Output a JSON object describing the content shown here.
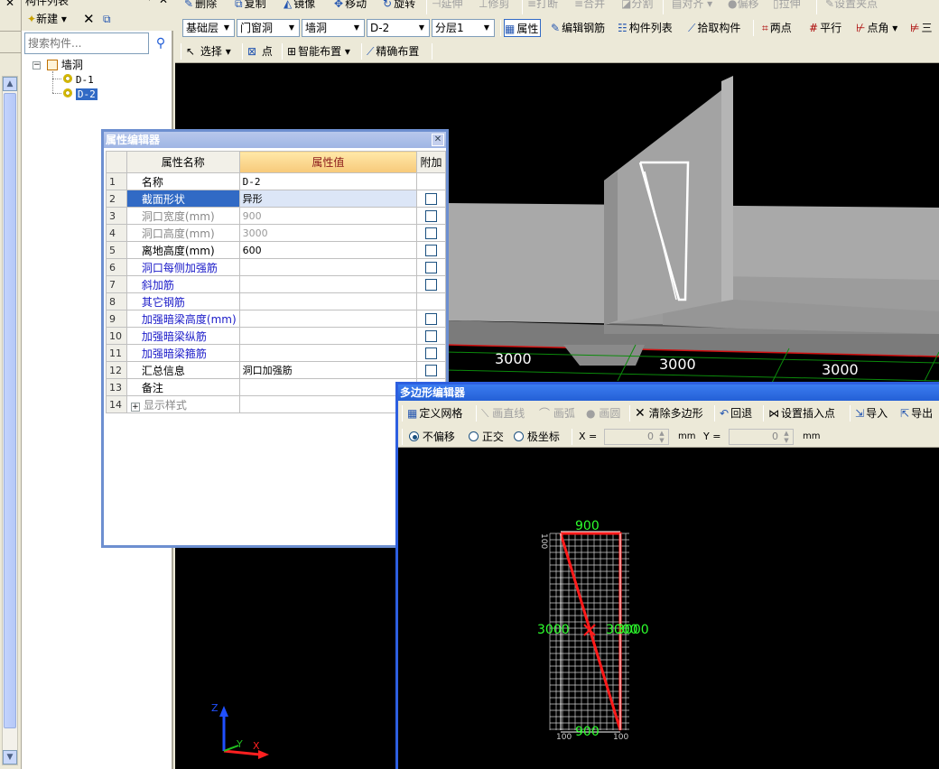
{
  "comp_panel": {
    "title": "构件列表",
    "new_label": "新建",
    "search_placeholder": "搜索构件...",
    "tree": {
      "root_label": "墙洞",
      "items": [
        "D-1",
        "D-2"
      ]
    }
  },
  "toolbar1": {
    "items": [
      "删除",
      "复制",
      "镜像",
      "移动",
      "旋转",
      "延伸",
      "修剪",
      "打断",
      "合并",
      "分割",
      "对齐",
      "偏移",
      "拉伸",
      "设置夹点"
    ]
  },
  "toolbar2": {
    "floor_combo": "基础层",
    "type_combo": "门窗洞",
    "sub_combo": "墙洞",
    "name_combo": "D-2",
    "layer_combo": "分层1",
    "attr_btn": "属性",
    "edit_rebar_btn": "编辑钢筋",
    "comp_list_btn": "构件列表",
    "pick_btn": "拾取构件",
    "two_point_btn": "两点",
    "parallel_btn": "平行",
    "point_angle_btn": "点角",
    "three_btn": "三"
  },
  "toolbar3": {
    "select_btn": "选择",
    "point_btn": "点",
    "smart_btn": "智能布置",
    "precise_btn": "精确布置"
  },
  "viewport": {
    "dim_labels": [
      "3000",
      "3000",
      "3000"
    ]
  },
  "prop_editor": {
    "title": "属性编辑器",
    "col_name": "属性名称",
    "col_value": "属性值",
    "col_add": "附加",
    "rows": [
      {
        "num": "1",
        "name": "名称",
        "value": "D-2"
      },
      {
        "num": "2",
        "name": "截面形状",
        "value": "异形"
      },
      {
        "num": "3",
        "name": "洞口宽度(mm)",
        "value": "900"
      },
      {
        "num": "4",
        "name": "洞口高度(mm)",
        "value": "3000"
      },
      {
        "num": "5",
        "name": "离地高度(mm)",
        "value": "600"
      },
      {
        "num": "6",
        "name": "洞口每侧加强筋",
        "value": ""
      },
      {
        "num": "7",
        "name": "斜加筋",
        "value": ""
      },
      {
        "num": "8",
        "name": "其它钢筋",
        "value": ""
      },
      {
        "num": "9",
        "name": "加强暗梁高度(mm)",
        "value": ""
      },
      {
        "num": "10",
        "name": "加强暗梁纵筋",
        "value": ""
      },
      {
        "num": "11",
        "name": "加强暗梁箍筋",
        "value": ""
      },
      {
        "num": "12",
        "name": "汇总信息",
        "value": "洞口加强筋"
      },
      {
        "num": "13",
        "name": "备注",
        "value": ""
      },
      {
        "num": "14",
        "name": "显示样式",
        "value": ""
      }
    ]
  },
  "poly_editor": {
    "title": "多边形编辑器",
    "define_grid_btn": "定义网格",
    "draw_line_btn": "画直线",
    "draw_arc_btn": "画弧",
    "draw_circle_btn": "画圆",
    "clear_poly_btn": "清除多边形",
    "undo_btn": "回退",
    "set_insert_btn": "设置插入点",
    "import_btn": "导入",
    "export_btn": "导出",
    "opt_no_offset": "不偏移",
    "opt_ortho": "正交",
    "opt_polar": "极坐标",
    "x_label": "X =",
    "x_value": "0",
    "y_label": "Y =",
    "y_value": "0",
    "unit": "mm",
    "dims": {
      "top": "900",
      "bottom": "900",
      "left": "3000",
      "right": "3000",
      "right2": "3000",
      "tick_left": "100",
      "tick_bottom_l": "100",
      "tick_bottom_r": "100"
    }
  },
  "axis": {
    "z": "Z",
    "x": "X",
    "y": "Y"
  }
}
